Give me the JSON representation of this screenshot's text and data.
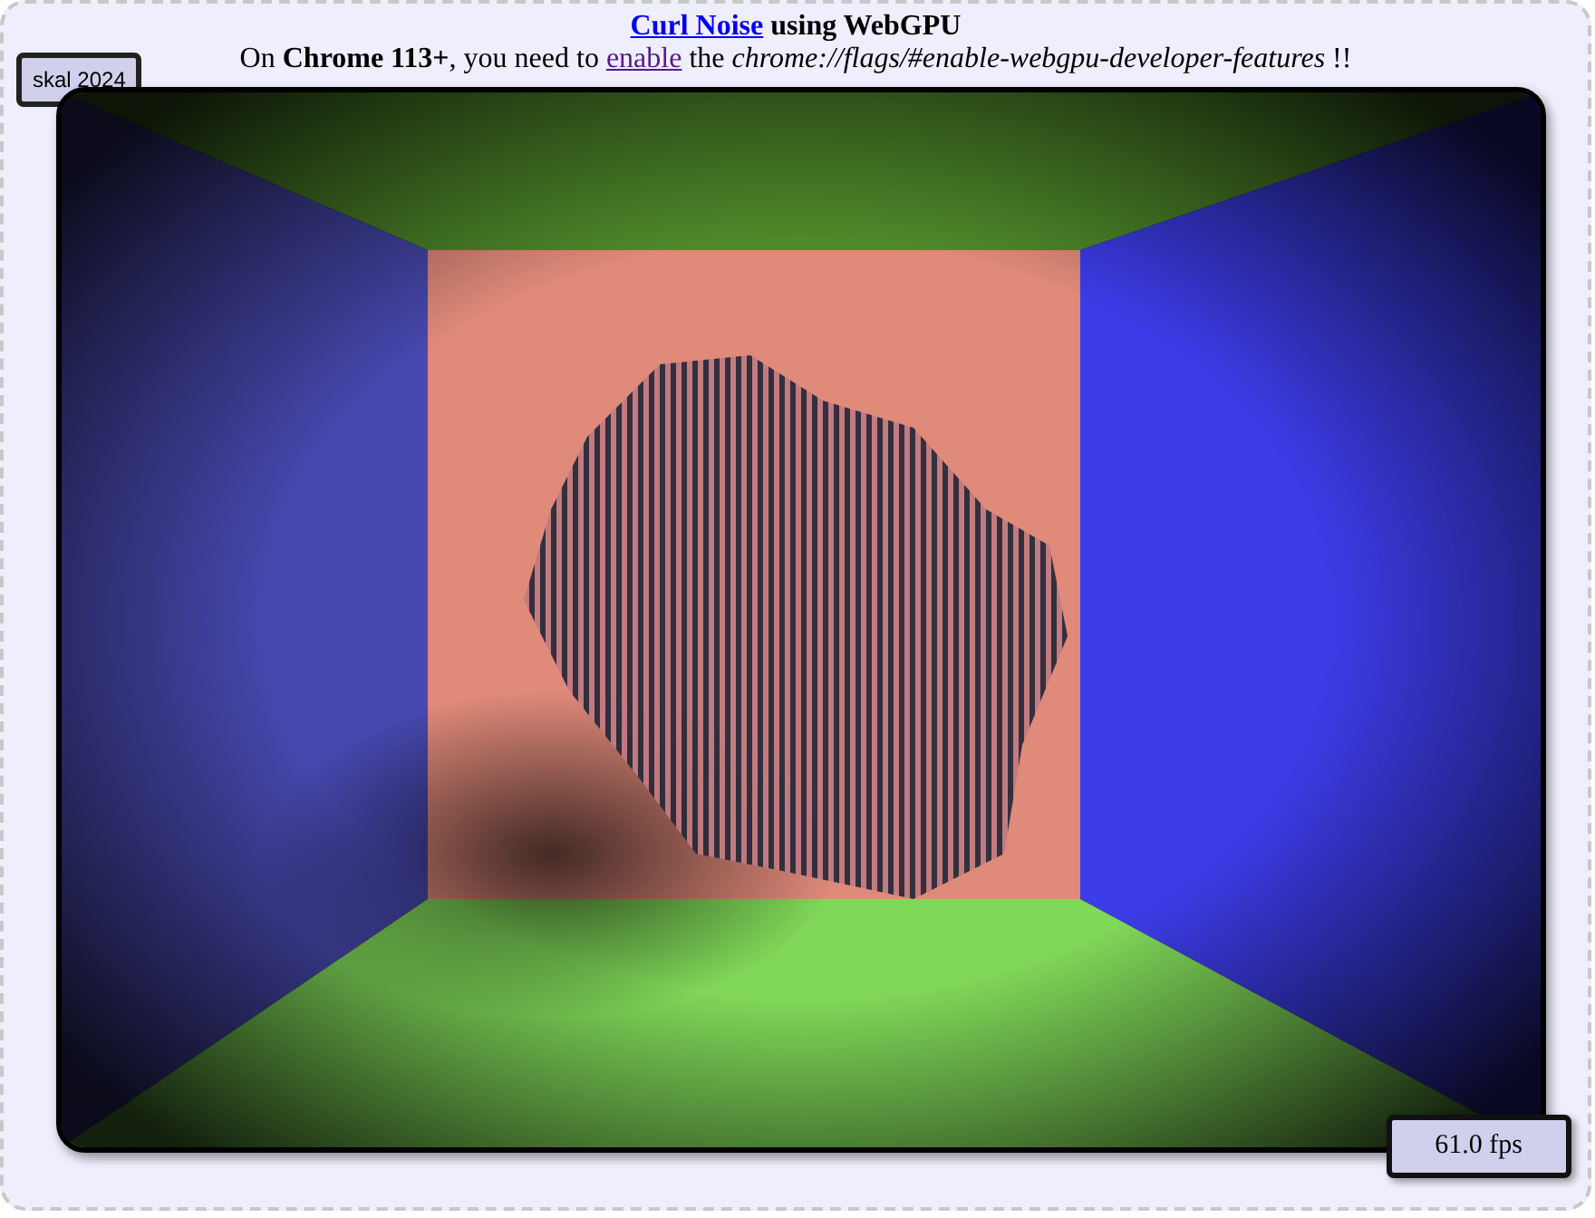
{
  "header": {
    "title": {
      "link": "Curl Noise",
      "text": "using WebGPU"
    },
    "notice": {
      "before": "On **Chrome 113+**, you need to",
      "link": "enable",
      "after": "the *chrome://flags/#enable-webgpu-developer-features* !!"
    }
  },
  "author_badge": "skal 2024",
  "fps": "61.0 fps"
}
